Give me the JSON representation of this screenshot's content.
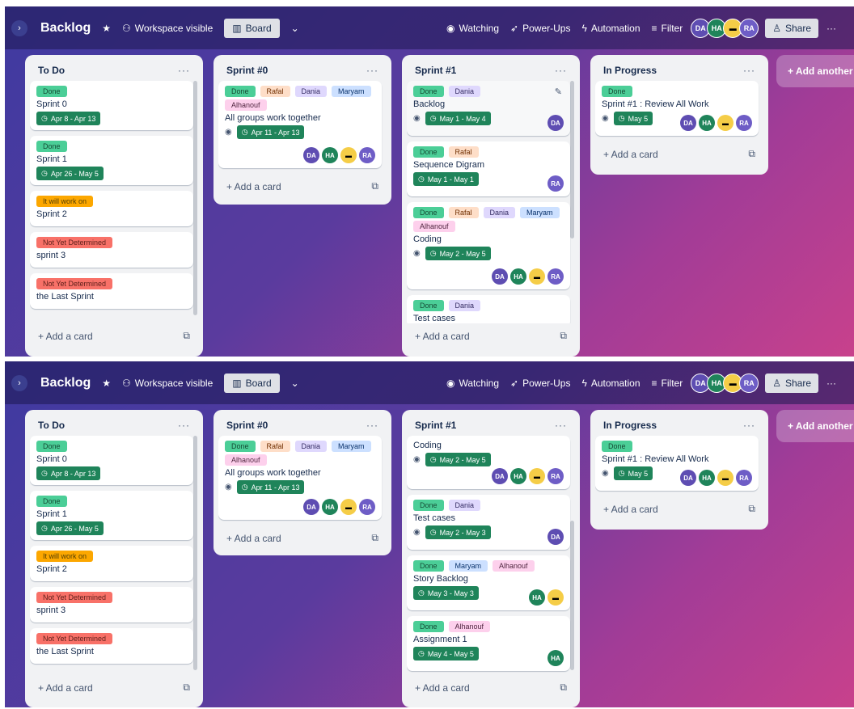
{
  "topbar": {
    "board_title": "Backlog",
    "star_icon": "star-icon",
    "visibility": "Workspace visible",
    "view_button": "Board",
    "watching": "Watching",
    "powerups": "Power-Ups",
    "automation": "Automation",
    "filter": "Filter",
    "share": "Share",
    "more": "···",
    "members": [
      "DA",
      "HA",
      "",
      "RA"
    ]
  },
  "add_another": "+ Add another",
  "add_card": "+ Add a card",
  "colors": {
    "done": "#4bce97",
    "date": "#1f845a",
    "work": "#fca700",
    "nyd": "#f87168"
  },
  "screen1": {
    "lists": [
      {
        "title": "To Do",
        "menu": "···",
        "cards": [
          {
            "labels": [
              "Done"
            ],
            "title": "Sprint 0",
            "date": "Apr 8 - Apr 13"
          },
          {
            "labels": [
              "Done"
            ],
            "title": "Sprint 1",
            "date": "Apr 26 - May 5"
          },
          {
            "labels": [
              "It will work on"
            ],
            "title": "Sprint 2"
          },
          {
            "labels": [
              "Not Yet Determined"
            ],
            "title": "sprint 3"
          },
          {
            "labels": [
              "Not Yet Determined"
            ],
            "title": "the Last Sprint"
          }
        ]
      },
      {
        "title": "Sprint #0",
        "menu": "···",
        "cards": [
          {
            "labels": [
              "Done",
              "Rafal",
              "Dania",
              "Maryam",
              "Alhanouf"
            ],
            "title": "All groups work together",
            "date": "Apr 11 - Apr 13",
            "members": [
              "DA",
              "HA",
              "",
              "RA"
            ]
          }
        ]
      },
      {
        "title": "Sprint #1",
        "menu": "···",
        "cards": [
          {
            "labels": [
              "Done",
              "Dania"
            ],
            "title": "Backlog",
            "date": "May 1 - May 4",
            "members": [
              "DA"
            ]
          },
          {
            "labels": [
              "Done",
              "Rafal"
            ],
            "title": "Sequence Digram",
            "date": "May 1 - May 1",
            "members": [
              "RA"
            ]
          },
          {
            "labels": [
              "Done",
              "Rafal",
              "Dania",
              "Maryam",
              "Alhanouf"
            ],
            "title": "Coding",
            "date": "May 2 - May 5",
            "members": [
              "DA",
              "HA",
              "",
              "RA"
            ]
          },
          {
            "labels": [
              "Done",
              "Dania"
            ],
            "title": "Test cases"
          }
        ]
      },
      {
        "title": "In Progress",
        "menu": "···",
        "cards": [
          {
            "labels": [
              "Done"
            ],
            "title": "Sprint #1 : Review All Work",
            "date": "May 5",
            "members": [
              "DA",
              "HA",
              "",
              "RA"
            ]
          }
        ]
      }
    ]
  },
  "screen2": {
    "lists": [
      {
        "title": "To Do",
        "menu": "···",
        "cards": [
          {
            "labels": [
              "Done"
            ],
            "title": "Sprint 0",
            "date": "Apr 8 - Apr 13"
          },
          {
            "labels": [
              "Done"
            ],
            "title": "Sprint 1",
            "date": "Apr 26 - May 5"
          },
          {
            "labels": [
              "It will work on"
            ],
            "title": "Sprint 2"
          },
          {
            "labels": [
              "Not Yet Determined"
            ],
            "title": "sprint 3"
          },
          {
            "labels": [
              "Not Yet Determined"
            ],
            "title": "the Last Sprint"
          }
        ]
      },
      {
        "title": "Sprint #0",
        "menu": "···",
        "cards": [
          {
            "labels": [
              "Done",
              "Rafal",
              "Dania",
              "Maryam",
              "Alhanouf"
            ],
            "title": "All groups work together",
            "date": "Apr 11 - Apr 13",
            "members": [
              "DA",
              "HA",
              "",
              "RA"
            ]
          }
        ]
      },
      {
        "title": "Sprint #1",
        "menu": "···",
        "cards": [
          {
            "labels": [],
            "title": "Coding",
            "date": "May 2 - May 5",
            "members": [
              "DA",
              "HA",
              "",
              "RA"
            ]
          },
          {
            "labels": [
              "Done",
              "Dania"
            ],
            "title": "Test cases",
            "date": "May 2 - May 3",
            "members": [
              "DA"
            ]
          },
          {
            "labels": [
              "Done",
              "Maryam",
              "Alhanouf"
            ],
            "title": "Story Backlog",
            "date": "May 3 - May 3",
            "members": [
              "HA",
              ""
            ]
          },
          {
            "labels": [
              "Done",
              "Alhanouf"
            ],
            "title": "Assignment 1",
            "date": "May 4 - May 5",
            "members": [
              "HA"
            ]
          }
        ]
      },
      {
        "title": "In Progress",
        "menu": "···",
        "cards": [
          {
            "labels": [
              "Done"
            ],
            "title": "Sprint #1 : Review All Work",
            "date": "May 5",
            "members": [
              "DA",
              "HA",
              "",
              "RA"
            ]
          }
        ]
      }
    ]
  }
}
